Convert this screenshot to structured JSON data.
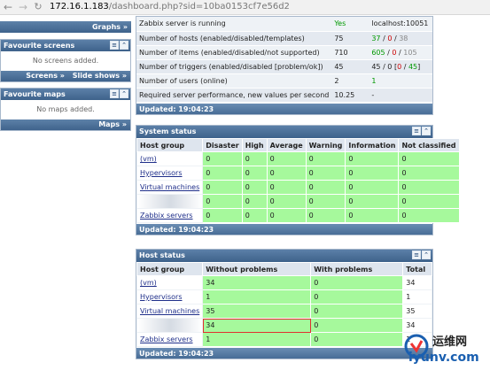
{
  "browser": {
    "url_host": "172.16.1.183",
    "url_path": "/dashboard.php?sid=10ba0153cf7e56d2"
  },
  "left": {
    "graphs_link": "Graphs »",
    "favourite_screens": {
      "title": "Favourite screens",
      "empty": "No screens added.",
      "footer_links": [
        "Screens »",
        "Slide shows »"
      ]
    },
    "favourite_maps": {
      "title": "Favourite maps",
      "empty": "No maps added.",
      "footer_links": [
        "Maps »"
      ]
    }
  },
  "server_info": {
    "rows": [
      {
        "label": "Zabbix server is running",
        "value": "Yes",
        "value_color": "green",
        "details": "localhost:10051"
      },
      {
        "label": "Number of hosts (enabled/disabled/templates)",
        "value": "75",
        "details_parts": [
          {
            "t": "37",
            "c": "green"
          },
          {
            "t": " / ",
            "c": ""
          },
          {
            "t": "0",
            "c": "red"
          },
          {
            "t": " / ",
            "c": ""
          },
          {
            "t": "38",
            "c": "grey"
          }
        ]
      },
      {
        "label": "Number of items (enabled/disabled/not supported)",
        "value": "710",
        "details_parts": [
          {
            "t": "605",
            "c": "green"
          },
          {
            "t": " / ",
            "c": ""
          },
          {
            "t": "0",
            "c": "red"
          },
          {
            "t": " / ",
            "c": ""
          },
          {
            "t": "105",
            "c": "grey"
          }
        ]
      },
      {
        "label": "Number of triggers (enabled/disabled [problem/ok])",
        "value": "45",
        "details_parts": [
          {
            "t": "45 / 0 [",
            "c": ""
          },
          {
            "t": "0",
            "c": "red"
          },
          {
            "t": " / ",
            "c": ""
          },
          {
            "t": "45",
            "c": "green"
          },
          {
            "t": "]",
            "c": ""
          }
        ]
      },
      {
        "label": "Number of users (online)",
        "value": "2",
        "details_parts": [
          {
            "t": "1",
            "c": "green"
          }
        ]
      },
      {
        "label": "Required server performance, new values per second",
        "value": "10.25",
        "details": "-"
      }
    ],
    "updated": "Updated: 19:04:23"
  },
  "system_status": {
    "title": "System status",
    "headers": [
      "Host group",
      "Disaster",
      "High",
      "Average",
      "Warning",
      "Information",
      "Not classified"
    ],
    "rows": [
      {
        "group": "(vm)",
        "values": [
          "0",
          "0",
          "0",
          "0",
          "0",
          "0"
        ]
      },
      {
        "group": "Hypervisors",
        "values": [
          "0",
          "0",
          "0",
          "0",
          "0",
          "0"
        ]
      },
      {
        "group": "Virtual machines",
        "values": [
          "0",
          "0",
          "0",
          "0",
          "0",
          "0"
        ]
      },
      {
        "group": "",
        "values": [
          "0",
          "0",
          "0",
          "0",
          "0",
          "0"
        ]
      },
      {
        "group": "Zabbix servers",
        "values": [
          "0",
          "0",
          "0",
          "0",
          "0",
          "0"
        ]
      }
    ],
    "updated": "Updated: 19:04:23"
  },
  "host_status": {
    "title": "Host status",
    "headers": [
      "Host group",
      "Without problems",
      "With problems",
      "Total"
    ],
    "rows": [
      {
        "group": "(vm)",
        "without": "34",
        "with": "0",
        "total": "34"
      },
      {
        "group": "Hypervisors",
        "without": "1",
        "with": "0",
        "total": "1"
      },
      {
        "group": "Virtual machines",
        "without": "35",
        "with": "0",
        "total": "35"
      },
      {
        "group": "",
        "without": "34",
        "with": "0",
        "total": "34"
      },
      {
        "group": "Zabbix servers",
        "without": "1",
        "with": "0",
        "total": "1"
      }
    ],
    "updated": "Updated: 19:04:23"
  },
  "watermark": {
    "cn": "运维网",
    "en": "iyunv.com"
  }
}
